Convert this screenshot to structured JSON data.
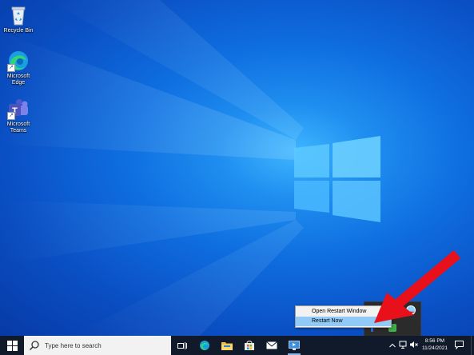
{
  "desktop": {
    "icons": [
      {
        "label": "Recycle Bin",
        "icon": "recycle-bin-icon"
      },
      {
        "label_line1": "Microsoft",
        "label_line2": "Edge",
        "icon": "edge-icon"
      },
      {
        "label_line1": "Microsoft",
        "label_line2": "Teams",
        "icon": "teams-icon"
      }
    ]
  },
  "context_menu": {
    "items": [
      {
        "label": "Open Restart Window"
      },
      {
        "label": "Restart Now"
      }
    ]
  },
  "taskbar": {
    "search_placeholder": "Type here to search",
    "pinned": [
      "task-view-icon",
      "edge-icon",
      "file-explorer-icon",
      "store-icon",
      "mail-icon",
      "remote-desktop-icon"
    ]
  },
  "tray": {
    "time": "8:56 PM",
    "date": "11/24/2021"
  },
  "colors": {
    "annotation_arrow": "#e8101a",
    "menu_hover": "#91c9f7",
    "taskbar": "#101a2a"
  }
}
